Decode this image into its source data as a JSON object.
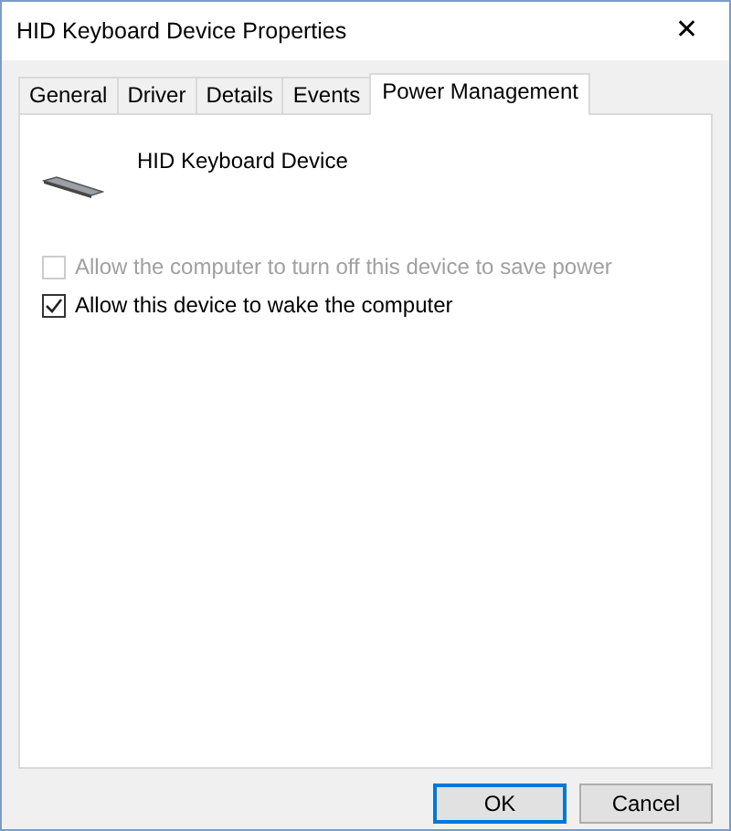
{
  "window": {
    "title": "HID Keyboard Device Properties",
    "close": "✕"
  },
  "tabs": [
    {
      "label": "General",
      "selected": false
    },
    {
      "label": "Driver",
      "selected": false
    },
    {
      "label": "Details",
      "selected": false
    },
    {
      "label": "Events",
      "selected": false
    },
    {
      "label": "Power Management",
      "selected": true
    }
  ],
  "device": {
    "name": "HID Keyboard Device"
  },
  "options": [
    {
      "label": "Allow the computer to turn off this device to save power",
      "checked": false,
      "disabled": true
    },
    {
      "label": "Allow this device to wake the computer",
      "checked": true,
      "disabled": false
    }
  ],
  "buttons": [
    {
      "label": "OK",
      "default": true
    },
    {
      "label": "Cancel",
      "default": false
    }
  ]
}
